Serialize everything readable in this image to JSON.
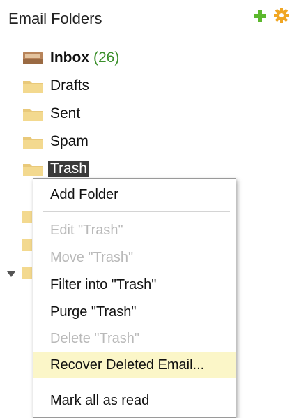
{
  "header": {
    "title": "Email Folders",
    "add_icon": "plus-icon",
    "settings_icon": "gear-icon"
  },
  "folders": [
    {
      "label": "Inbox",
      "count": "(26)",
      "icon": "inbox-tray-icon"
    },
    {
      "label": "Drafts",
      "icon": "folder-icon"
    },
    {
      "label": "Sent",
      "icon": "folder-icon"
    },
    {
      "label": "Spam",
      "icon": "folder-icon"
    },
    {
      "label": "Trash",
      "icon": "folder-icon",
      "selected": true
    }
  ],
  "context_menu": {
    "items": [
      {
        "label": "Add Folder",
        "enabled": true
      },
      {
        "label": "Edit \"Trash\"",
        "enabled": false
      },
      {
        "label": "Move \"Trash\"",
        "enabled": false
      },
      {
        "label": "Filter into \"Trash\"",
        "enabled": true
      },
      {
        "label": "Purge \"Trash\"",
        "enabled": true
      },
      {
        "label": "Delete \"Trash\"",
        "enabled": false
      },
      {
        "label": "Recover Deleted Email...",
        "enabled": true,
        "highlighted": true
      },
      {
        "label": "Mark all as read",
        "enabled": true
      }
    ]
  },
  "colors": {
    "count_green": "#3a8f2a",
    "highlight": "#fbf6c8",
    "selection": "#3b3b3b"
  }
}
